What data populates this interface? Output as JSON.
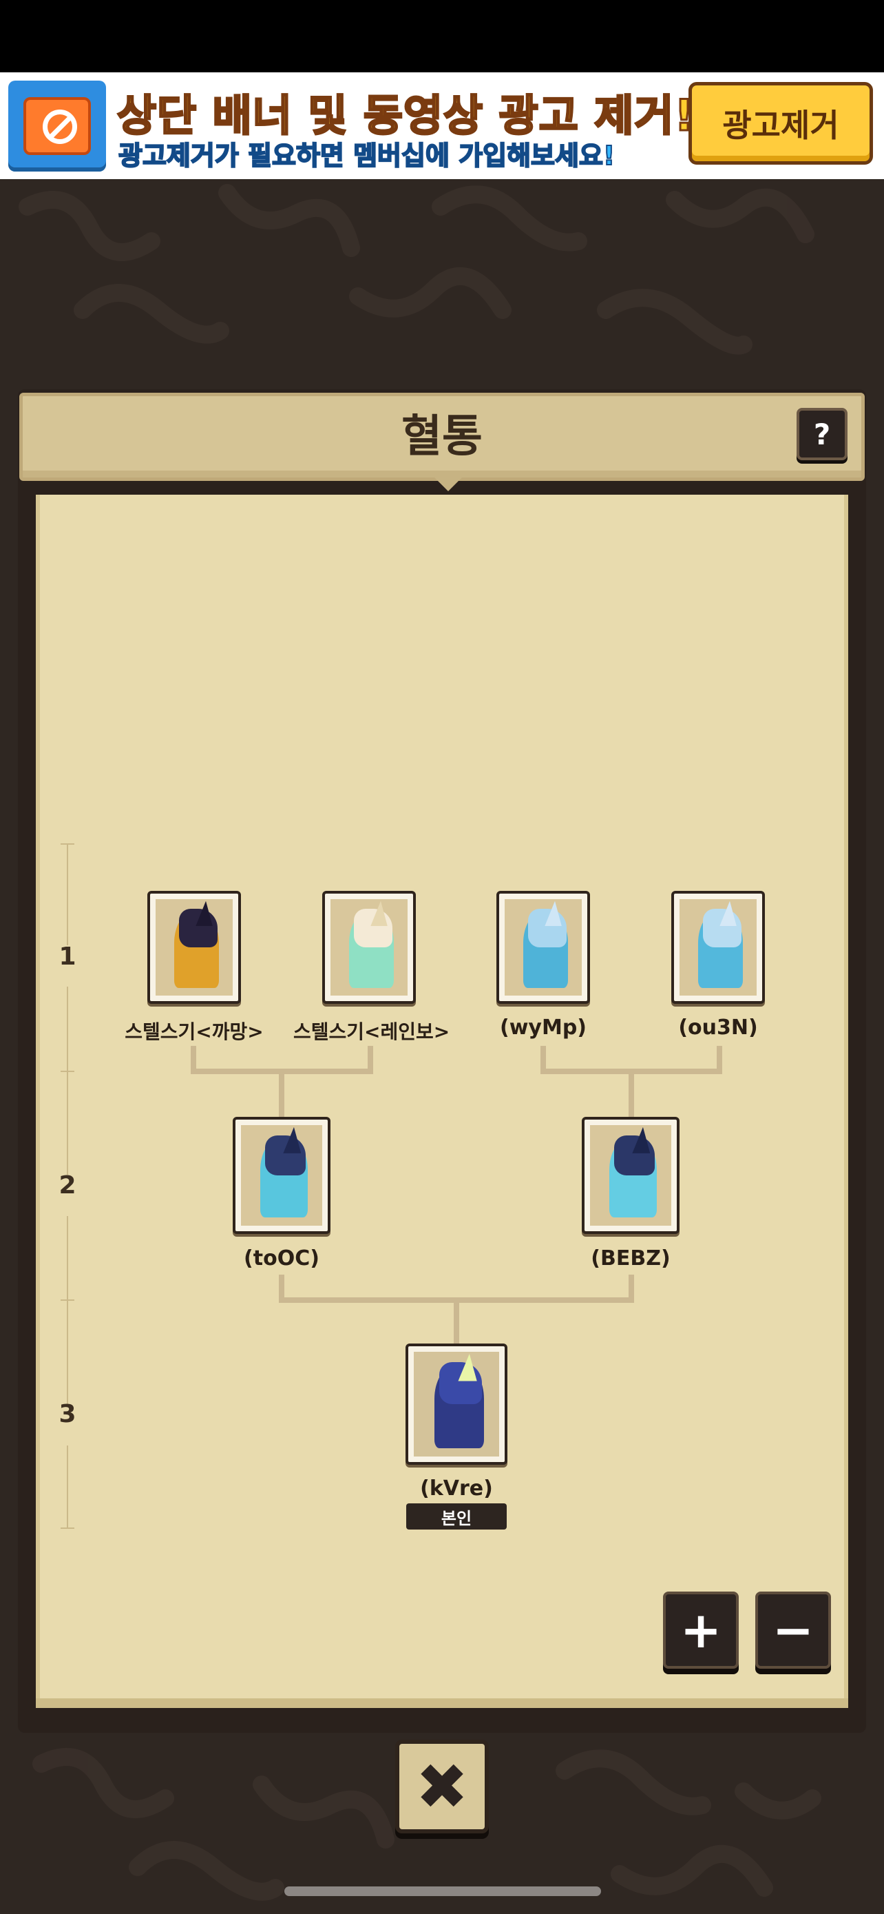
{
  "ad": {
    "title": "상단 배너 및 동영상 광고 제거!",
    "subtitle": "광고제거가 필요하면 멤버십에 가입해보세요!",
    "button_label": "광고제거"
  },
  "panel": {
    "title": "혈통",
    "help_label": "?"
  },
  "generations": [
    "1",
    "2",
    "3"
  ],
  "tree": {
    "gen1": [
      {
        "name": "스텔스기<까망>"
      },
      {
        "name": "스텔스기<레인보>"
      },
      {
        "name": "(wyMp)"
      },
      {
        "name": "(ou3N)"
      }
    ],
    "gen2": [
      {
        "name": "(toOC)"
      },
      {
        "name": "(BEBZ)"
      }
    ],
    "gen3": [
      {
        "name": "(kVre)",
        "badge": "본인"
      }
    ]
  },
  "controls": {
    "zoom_in": "+",
    "zoom_out": "−",
    "close": "✖"
  },
  "colors": {
    "paper": "#e8dbae",
    "header": "#d6c596",
    "dark": "#2b2320",
    "ad_yellow": "#ffcc3d",
    "ad_blue": "#2e8de0"
  }
}
